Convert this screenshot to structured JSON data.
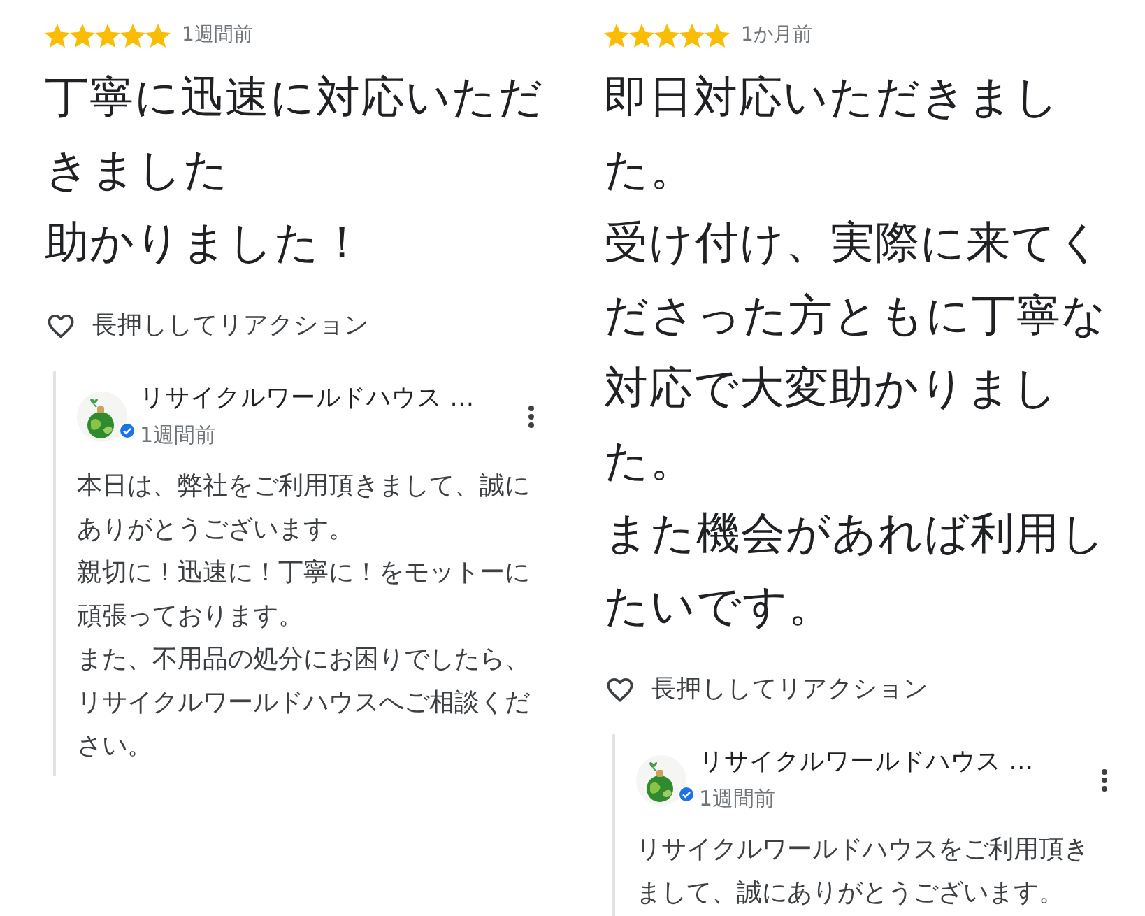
{
  "reviews": [
    {
      "stars": 5,
      "time": "1週間前",
      "text": [
        "丁寧に迅速に対応いただきました",
        "助かりました！"
      ],
      "reaction": "長押ししてリアクション",
      "reply": {
        "author": "リサイクルワールドハウス …",
        "verified": true,
        "time": "1週間前",
        "text": [
          "本日は、弊社をご利用頂きまして、誠にありがとうございます。",
          "親切に！迅速に！丁寧に！をモットーに頑張っております。",
          "また、不用品の処分にお困りでしたら、リサイクルワールドハウスへご相談ください。"
        ]
      }
    },
    {
      "stars": 5,
      "time": "1か月前",
      "text": [
        "即日対応いただきました。",
        "受け付け、実際に来てくださった方ともに丁寧な対応で大変助かりました。",
        "また機会があれば利用したいです。"
      ],
      "reaction": "長押ししてリアクション",
      "reply": {
        "author": "リサイクルワールドハウス …",
        "verified": true,
        "time": "1週間前",
        "text": [
          "リサイクルワールドハウスをご利用頂きまして、誠にありがとうございます。"
        ]
      }
    }
  ]
}
